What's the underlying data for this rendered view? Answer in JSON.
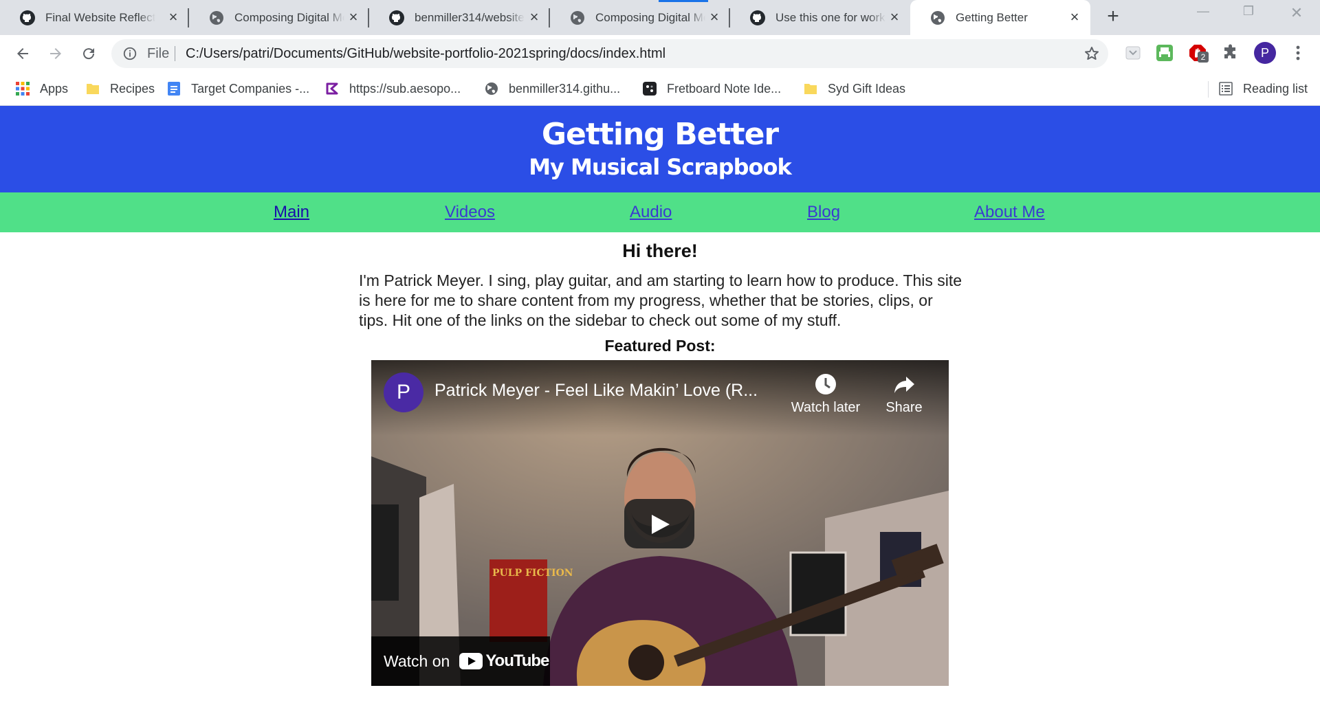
{
  "browser": {
    "tabs": [
      {
        "title": "Final Website Reflection",
        "favicon": "github-icon",
        "active": false
      },
      {
        "title": "Composing Digital Media",
        "favicon": "globe-icon",
        "active": false
      },
      {
        "title": "benmiller314/website",
        "favicon": "github-icon",
        "active": false
      },
      {
        "title": "Composing Digital Media",
        "favicon": "globe-icon",
        "active": false
      },
      {
        "title": "Use this one for work",
        "favicon": "github-icon",
        "active": false
      },
      {
        "title": "Getting Better",
        "favicon": "globe-icon",
        "active": true
      }
    ],
    "address": {
      "scheme": "File",
      "url": "C:/Users/patri/Documents/GitHub/website-portfolio-2021spring/docs/index.html"
    },
    "extension_badge": "2",
    "profile_initial": "P",
    "bookmarks": [
      {
        "label": "Apps",
        "icon": "apps-grid-icon"
      },
      {
        "label": "Recipes",
        "icon": "folder-icon"
      },
      {
        "label": "Target Companies -...",
        "icon": "docs-icon"
      },
      {
        "label": "https://sub.aesopo...",
        "icon": "aesop-icon"
      },
      {
        "label": "benmiller314.githu...",
        "icon": "globe-icon"
      },
      {
        "label": "Fretboard Note Ide...",
        "icon": "fretboard-icon"
      },
      {
        "label": "Syd Gift Ideas",
        "icon": "folder-icon"
      }
    ],
    "reading_list": "Reading list"
  },
  "site": {
    "title": "Getting Better",
    "subtitle": "My Musical Scrapbook",
    "nav": [
      {
        "label": "Main"
      },
      {
        "label": "Videos"
      },
      {
        "label": "Audio"
      },
      {
        "label": "Blog"
      },
      {
        "label": "About Me"
      }
    ],
    "greeting": "Hi there!",
    "intro": "I'm Patrick Meyer. I sing, play guitar, and am starting to learn how to produce. This site is here for me to share content from my progress, whether that be stories, clips, or tips. Hit one of the links on the sidebar to check out some of my stuff.",
    "featured_label": "Featured Post:"
  },
  "video": {
    "channel_initial": "P",
    "title": "Patrick Meyer - Feel Like Makin’ Love (R...",
    "watch_later": "Watch later",
    "share": "Share",
    "watch_on": "Watch on",
    "youtube": "YouTube",
    "poster_text": "PULP FICTION"
  },
  "colors": {
    "hero_bg": "#2b4ee6",
    "nav_bg": "#50e088",
    "link": "#3a3ad0",
    "tab_indicator": "#1a73e8"
  }
}
